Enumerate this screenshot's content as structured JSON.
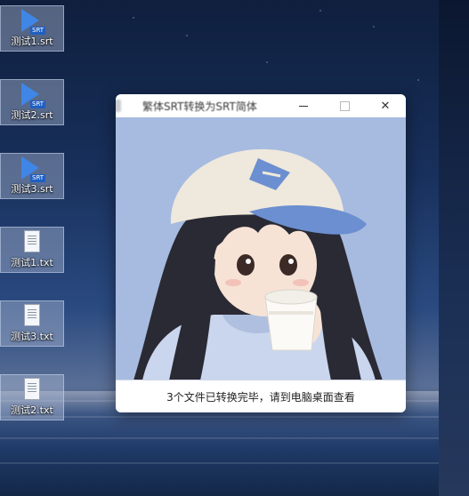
{
  "desktop": {
    "icons": [
      {
        "type": "srt",
        "label": "测试1.srt",
        "badge": "SRT",
        "icon": "srt-video-file-icon"
      },
      {
        "type": "srt",
        "label": "测试2.srt",
        "badge": "SRT",
        "icon": "srt-video-file-icon"
      },
      {
        "type": "srt",
        "label": "测试3.srt",
        "badge": "SRT",
        "icon": "srt-video-file-icon"
      },
      {
        "type": "txt",
        "label": "测试1.txt",
        "icon": "text-file-icon"
      },
      {
        "type": "txt",
        "label": "测试3.txt",
        "icon": "text-file-icon"
      },
      {
        "type": "txt",
        "label": "测试2.txt",
        "icon": "text-file-icon"
      }
    ]
  },
  "window": {
    "title": "繁体SRT转换为SRT简体",
    "controls": {
      "minimize_icon": "minimize-icon",
      "maximize_icon": "maximize-icon",
      "close_icon": "close-icon",
      "close_glyph": "✕"
    },
    "status_message": "3个文件已转换完毕，请到电脑桌面查看"
  },
  "colors": {
    "window_background": "#a7bbe0",
    "srt_icon_blue": "#3f86e6"
  }
}
